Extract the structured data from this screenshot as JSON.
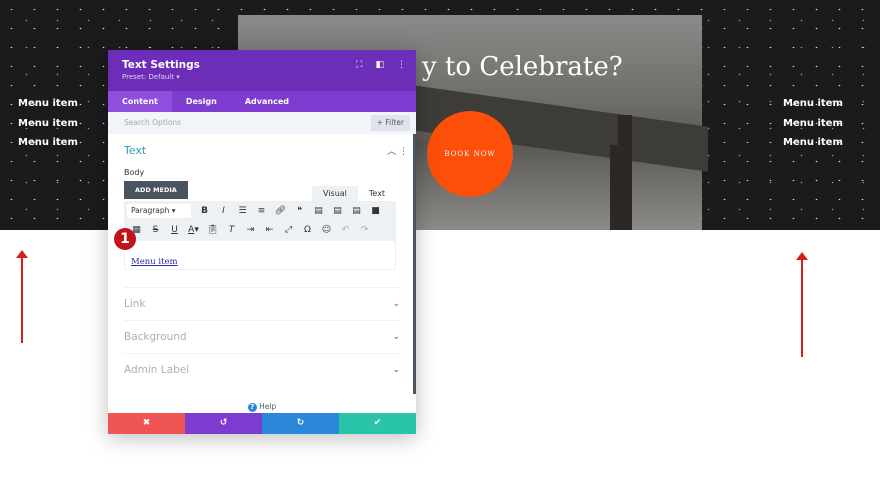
{
  "hero": {
    "headline": "y to Celebrate?",
    "book_now": "BOOK NOW",
    "left_menu": [
      "Menu item",
      "Menu item",
      "Menu item"
    ],
    "right_menu": [
      "Menu item",
      "Menu item",
      "Menu item"
    ],
    "accent": "#fc4f0a"
  },
  "modal": {
    "title": "Text Settings",
    "preset": "Preset: Default ▾",
    "tabs": [
      {
        "label": "Content"
      },
      {
        "label": "Design"
      },
      {
        "label": "Advanced"
      }
    ],
    "search_placeholder": "Search Options",
    "filter": "+ Filter",
    "section": "Text",
    "body_label": "Body",
    "add_media": "ADD MEDIA",
    "editor_tabs": {
      "visual": "Visual",
      "text": "Text"
    },
    "paragraph": "Paragraph",
    "editor_content": "Menu item",
    "badge": "1",
    "collapsed": [
      {
        "label": "Link"
      },
      {
        "label": "Background"
      },
      {
        "label": "Admin Label"
      }
    ],
    "help": "Help",
    "colors": {
      "header": "#6c2eb9",
      "cancel": "#ef5555",
      "undo": "#7e3bd0",
      "redo": "#2b87da",
      "save": "#29c4a9"
    }
  }
}
